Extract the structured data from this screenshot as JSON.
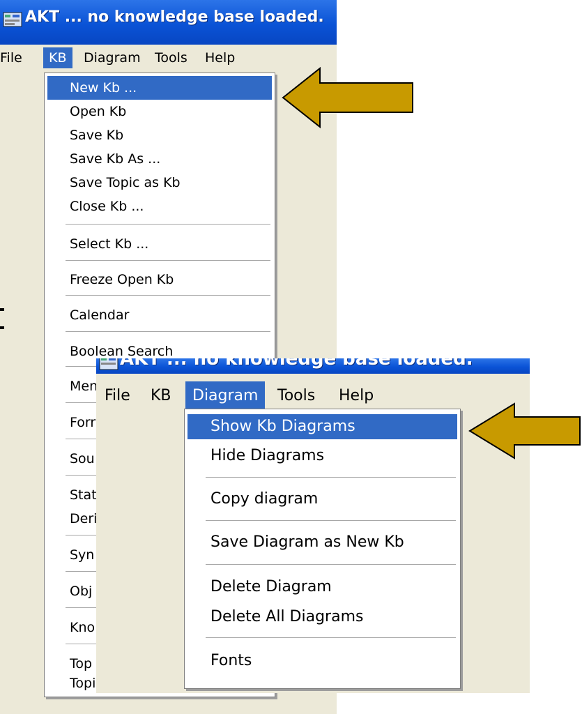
{
  "window1": {
    "title": "AKT ... no knowledge base loaded.",
    "menus": [
      "File",
      "KB",
      "Diagram",
      "Tools",
      "Help"
    ],
    "active_menu": "KB",
    "kb_menu": [
      {
        "label": "New Kb ...",
        "highlighted": true
      },
      {
        "label": "Open Kb"
      },
      {
        "label": "Save Kb"
      },
      {
        "label": "Save Kb As ..."
      },
      {
        "label": "Save Topic as Kb"
      },
      {
        "label": "Close Kb ..."
      },
      {
        "label": "Select Kb ..."
      },
      {
        "label": "Freeze Open Kb"
      },
      {
        "label": "Calendar"
      },
      {
        "label": "Boolean Search"
      },
      {
        "label": "Men"
      },
      {
        "label": "Forr"
      },
      {
        "label": "Sou"
      },
      {
        "label": "Stat"
      },
      {
        "label": "Deri"
      },
      {
        "label": "Syn"
      },
      {
        "label": "Obj"
      },
      {
        "label": "Kno"
      },
      {
        "label": "Top"
      },
      {
        "label": "Topic Hierarchies ..."
      }
    ]
  },
  "window2": {
    "title": "AKT ... no knowledge base loaded.",
    "menus": [
      "File",
      "KB",
      "Diagram",
      "Tools",
      "Help"
    ],
    "active_menu": "Diagram",
    "diagram_menu": [
      {
        "label": "Show Kb Diagrams",
        "highlighted": true
      },
      {
        "label": "Hide Diagrams"
      },
      {
        "label": "Copy diagram"
      },
      {
        "label": "Save Diagram as New Kb"
      },
      {
        "label": "Delete Diagram"
      },
      {
        "label": "Delete All Diagrams"
      },
      {
        "label": "Fonts"
      }
    ]
  },
  "colors": {
    "titlebar": "#0a53d6",
    "menu_highlight": "#316ac5",
    "window_bg": "#ece9d8",
    "arrow_fill": "#c89a00"
  },
  "icons": [
    "app-icon",
    "pointer-arrow-icon"
  ]
}
